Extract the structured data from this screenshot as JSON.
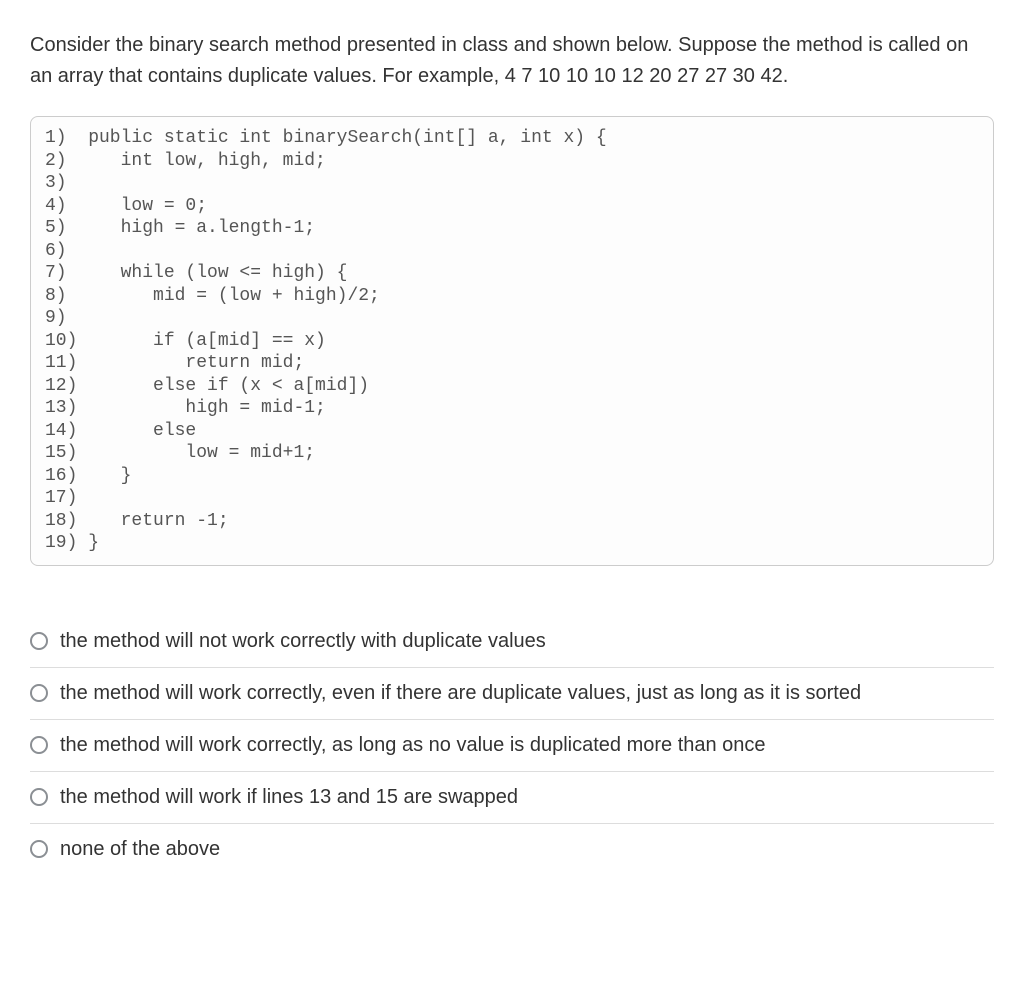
{
  "question": "Consider the binary search method presented in class and shown below. Suppose the method is called on an array that contains duplicate values. For example, 4  7  10  10  10  12  20  27  27  30  42.",
  "code": {
    "lines": [
      "1)  public static int binarySearch(int[] a, int x) {",
      "2)     int low, high, mid;",
      "3)",
      "4)     low = 0;",
      "5)     high = a.length-1;",
      "6)",
      "7)     while (low <= high) {",
      "8)        mid = (low + high)/2;",
      "9)",
      "10)       if (a[mid] == x)",
      "11)          return mid;",
      "12)       else if (x < a[mid])",
      "13)          high = mid-1;",
      "14)       else",
      "15)          low = mid+1;",
      "16)    }",
      "17)",
      "18)    return -1;",
      "19) }"
    ]
  },
  "options": [
    "the method will not work correctly with duplicate values",
    "the method will work correctly, even if there are duplicate values, just as long as it is sorted",
    "the method will work correctly, as long as no value is duplicated more than once",
    "the method will work if lines 13 and 15 are swapped",
    "none of the above"
  ]
}
